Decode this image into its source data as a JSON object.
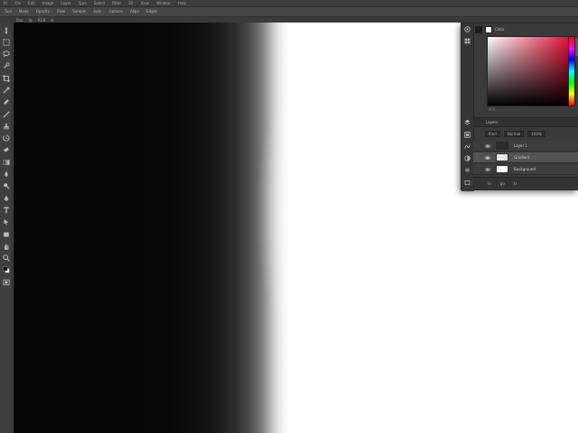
{
  "menubar": {
    "items": [
      "Ps",
      "File",
      "Edit",
      "Image",
      "Layer",
      "Type",
      "Select",
      "Filter",
      "3D",
      "View",
      "Window",
      "Help"
    ]
  },
  "optbar": {
    "items": [
      "Tool",
      "Mode",
      "Opacity",
      "Flow",
      "Sample",
      "Auto",
      "Options",
      "Align",
      "Edges"
    ]
  },
  "tabbar": {
    "items": [
      "Doc",
      "@",
      "RGB",
      "8"
    ]
  },
  "toolbar": {
    "tools": [
      "move-tool",
      "marquee-tool",
      "lasso-tool",
      "quick-select-tool",
      "crop-tool",
      "eyedropper-tool",
      "healing-tool",
      "brush-tool",
      "stamp-tool",
      "history-brush-tool",
      "eraser-tool",
      "gradient-tool",
      "blur-tool",
      "dodge-tool",
      "pen-tool",
      "type-tool",
      "path-select-tool",
      "shape-tool",
      "hand-tool",
      "zoom-tool",
      "color-swatches",
      "quick-mask"
    ]
  },
  "color_panel": {
    "tab": "Color",
    "foreground": "#1a1a1a",
    "background": "#ffffff",
    "readout": "# 0"
  },
  "layers_panel": {
    "tab": "Layers",
    "kind_filter": "Kind",
    "blend_mode": "Normal",
    "opacity": "100%",
    "layers": [
      {
        "name": "Layer 1",
        "thumb": "#2b2b2b",
        "visible": true,
        "selected": false
      },
      {
        "name": "Gradient",
        "thumb": "#e8e8e8",
        "visible": true,
        "selected": true
      },
      {
        "name": "Background",
        "thumb": "#ffffff",
        "visible": true,
        "selected": false
      }
    ],
    "footer": [
      "fx",
      "go",
      "fx"
    ]
  },
  "colors": {
    "accent": "#e3143a",
    "panel_bg": "#3a3a3a",
    "canvas_dark": "#050505",
    "canvas_light": "#ffffff"
  }
}
